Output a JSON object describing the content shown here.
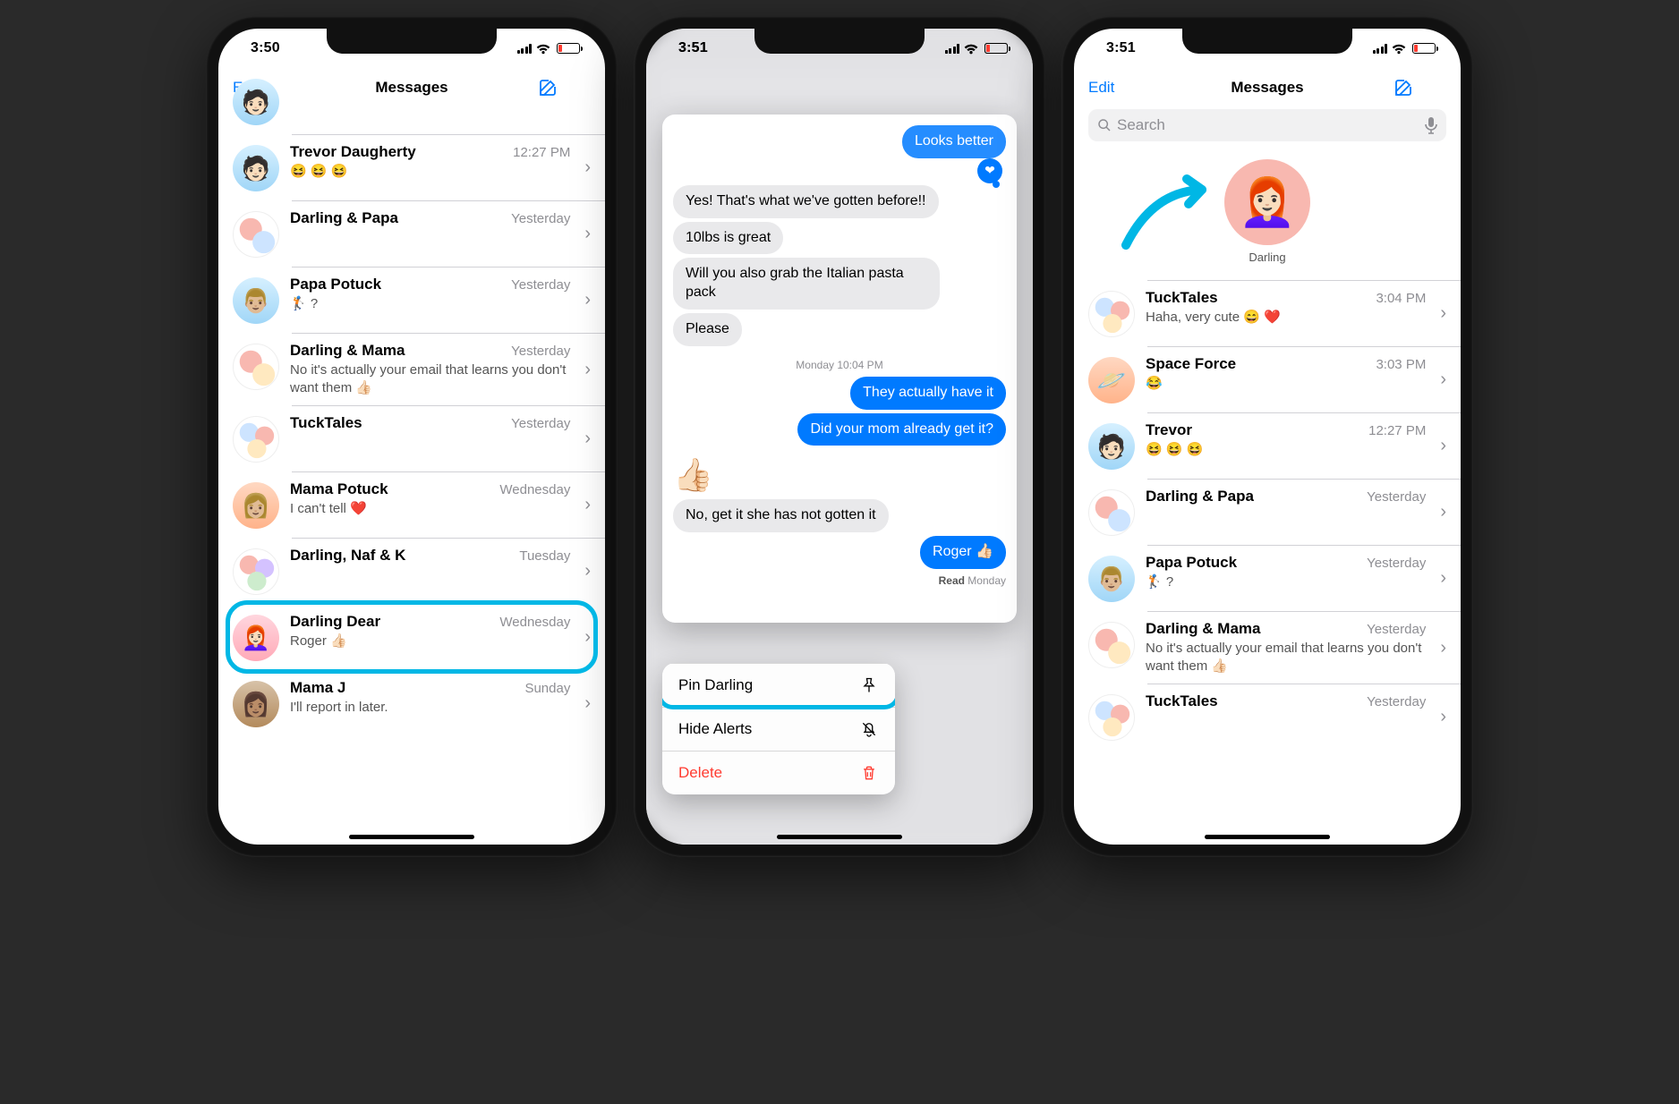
{
  "screens": {
    "s1": {
      "time": "3:50",
      "edit": "Edit",
      "title": "Messages",
      "rows": [
        {
          "name": "Trevor Daugherty",
          "time": "12:27 PM",
          "preview": "😆 😆 😆"
        },
        {
          "name": "Darling & Papa",
          "time": "Yesterday",
          "preview": ""
        },
        {
          "name": "Papa Potuck",
          "time": "Yesterday",
          "preview": "🏌️ ?"
        },
        {
          "name": "Darling & Mama",
          "time": "Yesterday",
          "preview": "No it's actually your email that learns you don't want them 👍🏻"
        },
        {
          "name": "TuckTales",
          "time": "Yesterday",
          "preview": ""
        },
        {
          "name": "Mama Potuck",
          "time": "Wednesday",
          "preview": "I can't tell ❤️"
        },
        {
          "name": "Darling, Naf & K",
          "time": "Tuesday",
          "preview": ""
        },
        {
          "name": "Darling Dear",
          "time": "Wednesday",
          "preview": "Roger 👍🏻"
        },
        {
          "name": "Mama J",
          "time": "Sunday",
          "preview": "I'll report in later."
        }
      ]
    },
    "s2": {
      "time": "3:51",
      "chat": {
        "out0": "Looks better",
        "in1": "Yes! That's what we've gotten before!!",
        "in2": "10lbs is great",
        "in3": "Will you also grab the Italian pasta pack",
        "in4": "Please",
        "ts": "Monday 10:04 PM",
        "out1": "They actually have it",
        "out2": "Did your mom already get it?",
        "in5": "No, get it she has not gotten it",
        "out3": "Roger 👍🏻",
        "read_label": "Read",
        "read_day": "Monday"
      },
      "menu": {
        "pin": "Pin Darling",
        "hide": "Hide Alerts",
        "del": "Delete"
      }
    },
    "s3": {
      "time": "3:51",
      "edit": "Edit",
      "title": "Messages",
      "search": "Search",
      "pinned_name": "Darling",
      "rows": [
        {
          "name": "TuckTales",
          "time": "3:04 PM",
          "preview": "Haha, very cute 😄 ❤️"
        },
        {
          "name": "Space Force",
          "time": "3:03 PM",
          "preview": "😂"
        },
        {
          "name": "Trevor",
          "time": "12:27 PM",
          "preview": "😆 😆 😆"
        },
        {
          "name": "Darling & Papa",
          "time": "Yesterday",
          "preview": ""
        },
        {
          "name": "Papa Potuck",
          "time": "Yesterday",
          "preview": "🏌️ ?"
        },
        {
          "name": "Darling & Mama",
          "time": "Yesterday",
          "preview": "No it's actually your email that learns you don't want them 👍🏻"
        },
        {
          "name": "TuckTales",
          "time": "Yesterday",
          "preview": ""
        }
      ]
    }
  }
}
